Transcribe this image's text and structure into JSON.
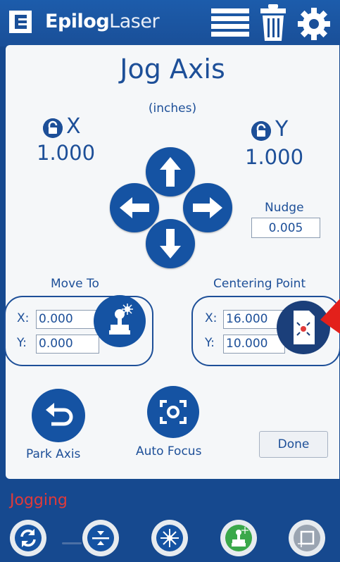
{
  "header": {
    "brand_bold": "Epilog",
    "brand_light": "Laser",
    "icons": [
      "menu-icon",
      "trash-icon",
      "gear-icon"
    ]
  },
  "dialog": {
    "title": "Jog Axis",
    "units": "(inches)",
    "x_axis": {
      "label": "X",
      "value": "1.000"
    },
    "y_axis": {
      "label": "Y",
      "value": "1.000"
    },
    "nudge": {
      "label": "Nudge",
      "value": "0.005"
    },
    "move_to": {
      "label": "Move To",
      "x_label": "X:",
      "x_value": "0.000",
      "y_label": "Y:",
      "y_value": "0.000"
    },
    "centering_point": {
      "label": "Centering Point",
      "x_label": "X:",
      "x_value": "16.000",
      "y_label": "Y:",
      "y_value": "10.000"
    },
    "park_axis_label": "Park Axis",
    "auto_focus_label": "Auto Focus",
    "done_label": "Done"
  },
  "status": {
    "text": "Jogging",
    "color": "#e03a3a"
  },
  "colors": {
    "brand_blue": "#1553a3",
    "panel": "#f5f7f9",
    "accent_green": "#3aa84a"
  },
  "bottom_bar": {
    "icons": [
      "refresh-icon",
      "focus-height-icon",
      "laser-icon",
      "jog-laser-icon",
      "frame-icon"
    ]
  }
}
